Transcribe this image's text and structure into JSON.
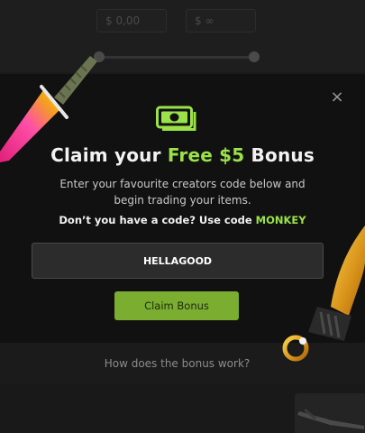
{
  "filters": {
    "price_min_placeholder": "$ 0,00",
    "price_max_placeholder": "$ ∞"
  },
  "modal": {
    "close_icon": "×",
    "icon": "money-icon",
    "title_prefix": "Claim your ",
    "title_highlight": "Free $5",
    "title_suffix": " Bonus",
    "description": "Enter your favourite creators code below and begin trading your items.",
    "hint_prefix": "Don’t you have a code? Use code ",
    "hint_code": "MONKEY",
    "code_value": "HELLAGOOD",
    "claim_button_label": "Claim Bonus"
  },
  "footer": {
    "how_link": "How does the bonus work?"
  },
  "colors": {
    "accent": "#9be249",
    "button": "#7aad30",
    "modal_bg": "#111111",
    "page_bg": "#1b1b1b"
  }
}
